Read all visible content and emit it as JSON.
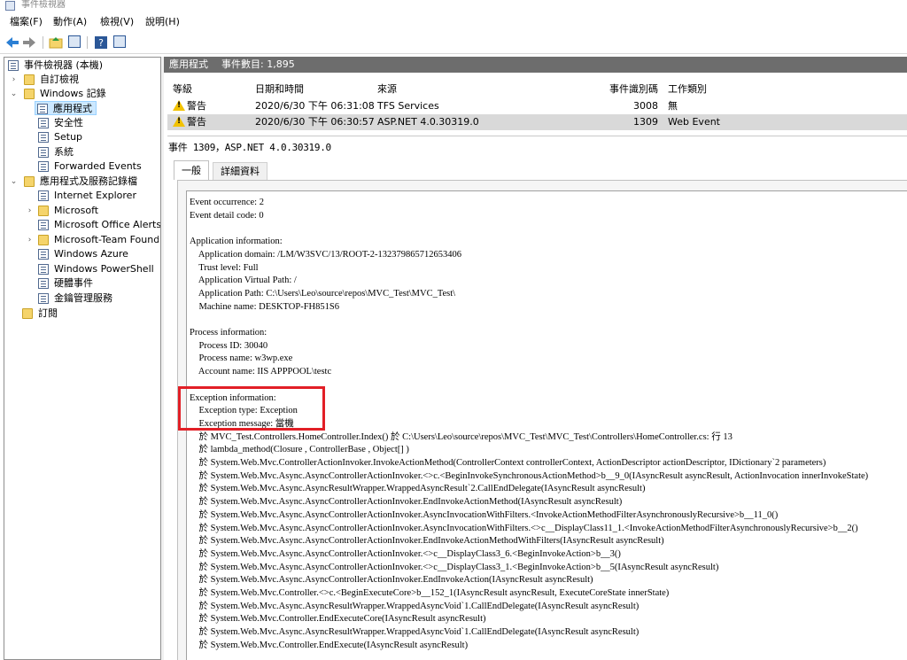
{
  "window": {
    "title": "事件檢視器"
  },
  "menu": [
    "檔案(F)",
    "動作(A)",
    "檢視(V)",
    "說明(H)"
  ],
  "toolbar": {
    "buttons": [
      "back-icon",
      "forward-icon",
      "up-folder-icon",
      "console-tree-icon",
      "help-icon",
      "show-panel-icon"
    ]
  },
  "tree": {
    "root": "事件檢視器 (本機)",
    "custom_views": "自訂檢視",
    "windows_logs": "Windows 記錄",
    "windows_logs_items": [
      "應用程式",
      "安全性",
      "Setup",
      "系統",
      "Forwarded Events"
    ],
    "app_services": "應用程式及服務記錄檔",
    "app_services_items": [
      "Internet Explorer",
      "Microsoft",
      "Microsoft Office Alerts",
      "Microsoft-Team Found",
      "Windows Azure",
      "Windows PowerShell",
      "硬體事件",
      "金鑰管理服務"
    ],
    "subscriptions": "訂閱"
  },
  "header": {
    "log_name": "應用程式",
    "event_count_label": "事件數目: 1,895"
  },
  "table": {
    "columns": [
      "等級",
      "日期和時間",
      "來源",
      "事件識別碼",
      "工作類別"
    ],
    "rows": [
      {
        "level": "警告",
        "datetime": "2020/6/30 下午 06:31:08",
        "source": "TFS Services",
        "event_id": "3008",
        "category": "無"
      },
      {
        "level": "警告",
        "datetime": "2020/6/30 下午 06:30:57",
        "source": "ASP.NET 4.0.30319.0",
        "event_id": "1309",
        "category": "Web Event"
      }
    ]
  },
  "detail": {
    "title": "事件 1309，ASP.NET 4.0.30319.0",
    "tabs": [
      "一般",
      "詳細資料"
    ],
    "lines": [
      "Event occurrence: 2",
      "Event detail code: 0",
      "",
      "Application information:",
      "    Application domain: /LM/W3SVC/13/ROOT-2-132379865712653406",
      "    Trust level: Full",
      "    Application Virtual Path: /",
      "    Application Path: C:\\Users\\Leo\\source\\repos\\MVC_Test\\MVC_Test\\",
      "    Machine name: DESKTOP-FH851S6",
      "",
      "Process information:",
      "    Process ID: 30040",
      "    Process name: w3wp.exe",
      "    Account name: IIS APPPOOL\\testc",
      "",
      "Exception information:",
      "    Exception type: Exception",
      "    Exception message: 當機",
      "    於 MVC_Test.Controllers.HomeController.Index() 於 C:\\Users\\Leo\\source\\repos\\MVC_Test\\MVC_Test\\Controllers\\HomeController.cs: 行 13",
      "    於 lambda_method(Closure , ControllerBase , Object[] )",
      "    於 System.Web.Mvc.ControllerActionInvoker.InvokeActionMethod(ControllerContext controllerContext, ActionDescriptor actionDescriptor, IDictionary`2 parameters)",
      "    於 System.Web.Mvc.Async.AsyncControllerActionInvoker.<>c.<BeginInvokeSynchronousActionMethod>b__9_0(IAsyncResult asyncResult, ActionInvocation innerInvokeState)",
      "    於 System.Web.Mvc.Async.AsyncResultWrapper.WrappedAsyncResult`2.CallEndDelegate(IAsyncResult asyncResult)",
      "    於 System.Web.Mvc.Async.AsyncControllerActionInvoker.EndInvokeActionMethod(IAsyncResult asyncResult)",
      "    於 System.Web.Mvc.Async.AsyncControllerActionInvoker.AsyncInvocationWithFilters.<InvokeActionMethodFilterAsynchronouslyRecursive>b__11_0()",
      "    於 System.Web.Mvc.Async.AsyncControllerActionInvoker.AsyncInvocationWithFilters.<>c__DisplayClass11_1.<InvokeActionMethodFilterAsynchronouslyRecursive>b__2()",
      "    於 System.Web.Mvc.Async.AsyncControllerActionInvoker.EndInvokeActionMethodWithFilters(IAsyncResult asyncResult)",
      "    於 System.Web.Mvc.Async.AsyncControllerActionInvoker.<>c__DisplayClass3_6.<BeginInvokeAction>b__3()",
      "    於 System.Web.Mvc.Async.AsyncControllerActionInvoker.<>c__DisplayClass3_1.<BeginInvokeAction>b__5(IAsyncResult asyncResult)",
      "    於 System.Web.Mvc.Async.AsyncControllerActionInvoker.EndInvokeAction(IAsyncResult asyncResult)",
      "    於 System.Web.Mvc.Controller.<>c.<BeginExecuteCore>b__152_1(IAsyncResult asyncResult, ExecuteCoreState innerState)",
      "    於 System.Web.Mvc.Async.AsyncResultWrapper.WrappedAsyncVoid`1.CallEndDelegate(IAsyncResult asyncResult)",
      "    於 System.Web.Mvc.Controller.EndExecuteCore(IAsyncResult asyncResult)",
      "    於 System.Web.Mvc.Async.AsyncResultWrapper.WrappedAsyncVoid`1.CallEndDelegate(IAsyncResult asyncResult)",
      "    於 System.Web.Mvc.Controller.EndExecute(IAsyncResult asyncResult)"
    ]
  },
  "colors": {
    "header_bg": "#6d6d6d",
    "selection": "#cce8ff",
    "highlight_box": "#e21f26",
    "warning": "#f2c200"
  }
}
